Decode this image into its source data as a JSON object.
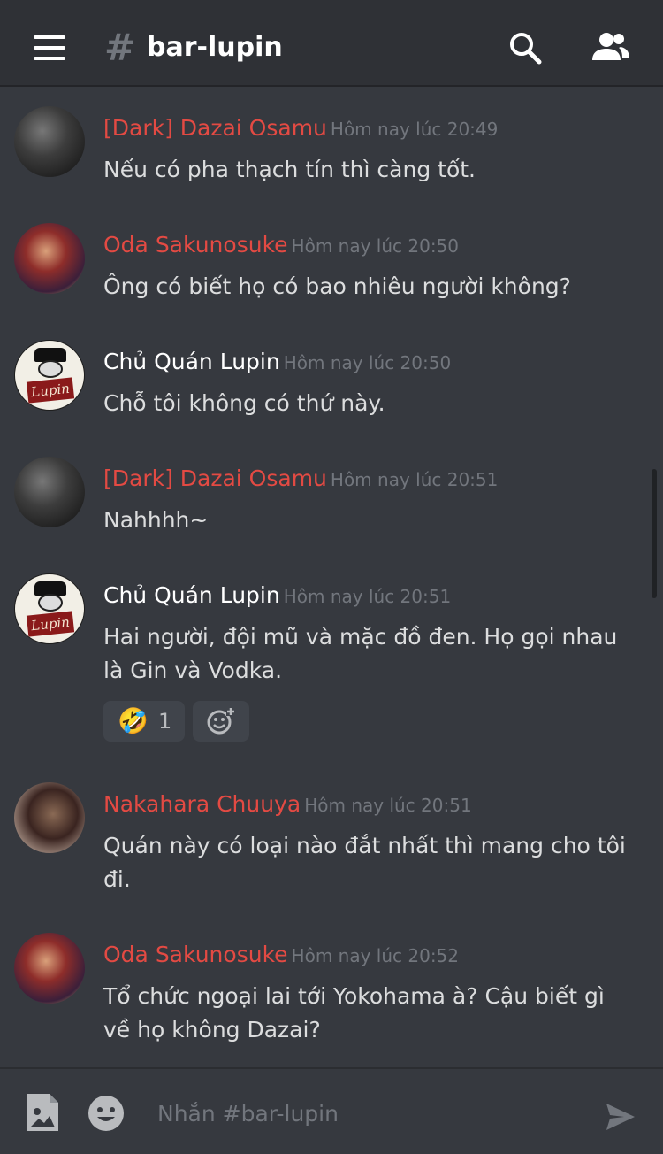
{
  "header": {
    "channel_hash": "#",
    "channel_name": "bar-lupin"
  },
  "messages": [
    {
      "author": "[Dark] Dazai Osamu",
      "time": "Hôm nay lúc 20:49",
      "text": "Nếu có pha thạch tín thì càng tốt.",
      "name_color": "#e34a43"
    },
    {
      "author": "Oda Sakunosuke",
      "time": "Hôm nay lúc 20:50",
      "text": "Ông có biết họ có bao nhiêu người không?",
      "name_color": "#e34a43"
    },
    {
      "author": "Chủ Quán Lupin",
      "time": "Hôm nay lúc 20:50",
      "text": "Chỗ tôi không có thứ này.",
      "name_color": "#ffffff"
    },
    {
      "author": "[Dark] Dazai Osamu",
      "time": "Hôm nay lúc 20:51",
      "text": "Nahhhh~",
      "name_color": "#e34a43"
    },
    {
      "author": "Chủ Quán Lupin",
      "time": "Hôm nay lúc 20:51",
      "text": "Hai người, đội mũ và mặc đồ đen. Họ gọi nhau là Gin và Vodka.",
      "name_color": "#ffffff",
      "reaction": {
        "emoji": "🤣",
        "count": "1"
      }
    },
    {
      "author": "Nakahara Chuuya",
      "time": "Hôm nay lúc 20:51",
      "text": "Quán này có loại nào đắt nhất thì mang cho tôi đi.",
      "name_color": "#e34a43"
    },
    {
      "author": "Oda Sakunosuke",
      "time": "Hôm nay lúc 20:52",
      "text": "Tổ chức ngoại lai tới Yokohama à? Cậu biết gì về họ không Dazai?",
      "name_color": "#e34a43"
    }
  ],
  "input": {
    "placeholder": "Nhắn #bar-lupin"
  },
  "icons": {
    "menu": "hamburger-menu-icon",
    "search": "search-icon",
    "members": "members-icon",
    "image": "image-icon",
    "emoji": "emoji-icon",
    "add_reaction": "add-reaction-icon",
    "send": "send-icon"
  },
  "colors": {
    "background": "#36393f",
    "header": "#2f3136",
    "accent_red": "#e34a43"
  }
}
